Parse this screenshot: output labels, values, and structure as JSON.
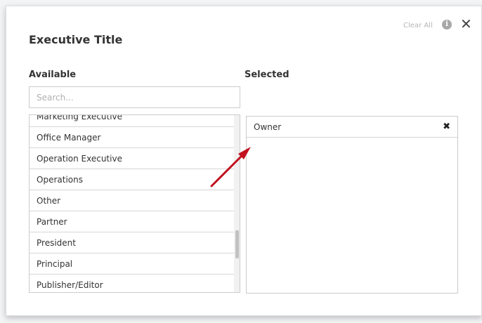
{
  "dialog": {
    "title": "Executive Title",
    "clear_all_label": "Clear All",
    "info_icon": "info-circle-icon",
    "close_icon": "close-icon",
    "close_glyph": "✕"
  },
  "available": {
    "label": "Available",
    "search_placeholder": "Search...",
    "items": [
      "Marketing Executive",
      "Office Manager",
      "Operation Executive",
      "Operations",
      "Other",
      "Partner",
      "President",
      "Principal",
      "Publisher/Editor"
    ]
  },
  "selected": {
    "label": "Selected",
    "items": [
      {
        "label": "Owner",
        "remove_glyph": "✖"
      }
    ]
  },
  "colors": {
    "annotation_arrow": "#c1121f"
  }
}
